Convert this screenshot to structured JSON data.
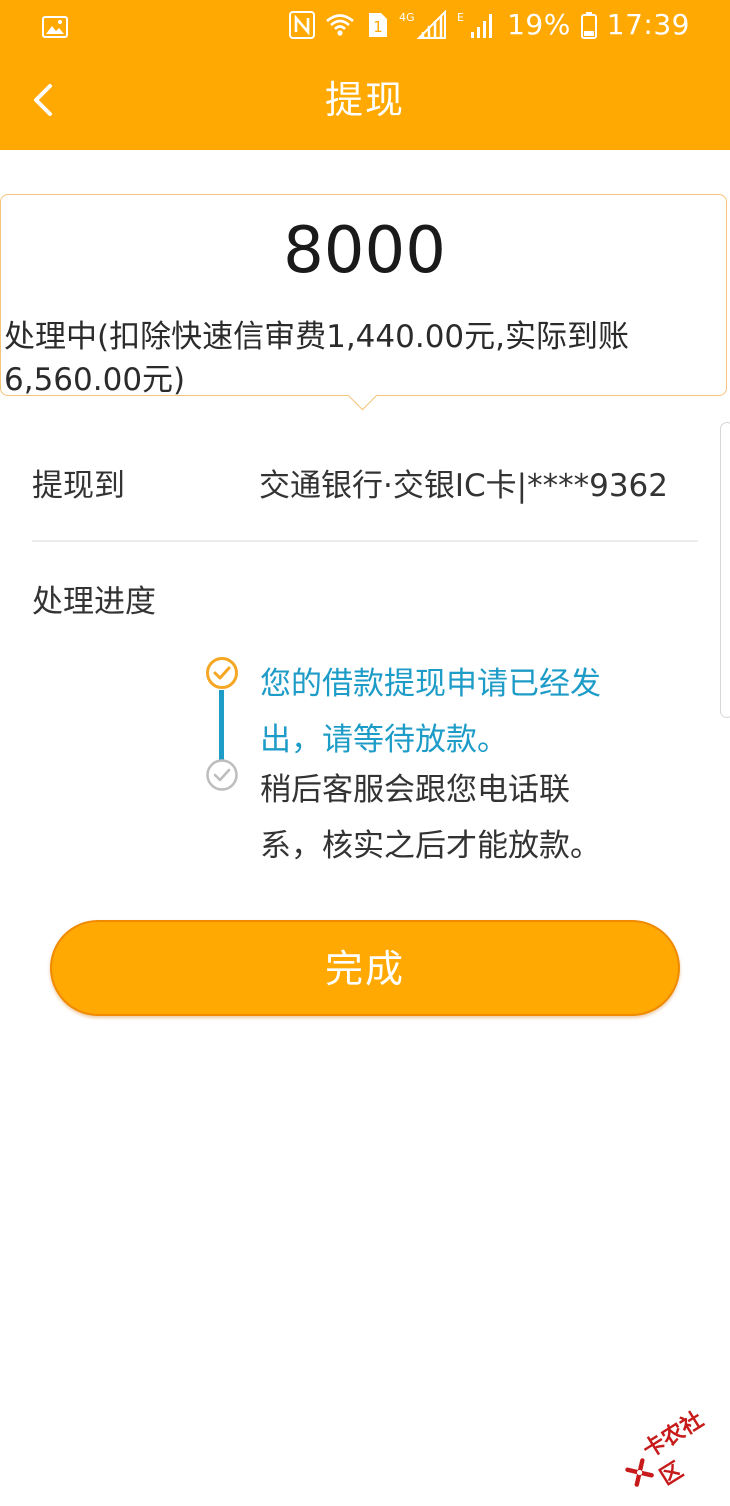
{
  "status_bar": {
    "battery_percent": "19%",
    "time": "17:39",
    "network_type": "4G",
    "mobile_data": "E",
    "sim_badge": "1",
    "icons": [
      "gallery-icon",
      "nfc-icon",
      "wifi-icon",
      "signal-icon",
      "battery-icon"
    ]
  },
  "header": {
    "title": "提现",
    "back_icon": "chevron-left-icon",
    "background_color": "#FFA902"
  },
  "amount_card": {
    "amount": "8000",
    "status_text": "处理中(扣除快速信审费1,440.00元,实际到账6,560.00元)"
  },
  "withdraw_row": {
    "label": "提现到",
    "value": "交通银行·交银IC卡|****9362"
  },
  "progress": {
    "label": "处理进度",
    "steps": [
      {
        "lines": [
          "您的借款提现申请已经发",
          "出，请等待放款。"
        ],
        "state": "done",
        "icon": "check-circle-icon",
        "color": "#1E9CC8"
      },
      {
        "lines": [
          "稍后客服会跟您电话联",
          "系，核实之后才能放款。"
        ],
        "state": "pending",
        "icon": "check-circle-icon",
        "color": "#333333"
      }
    ]
  },
  "done_button": {
    "label": "完成"
  },
  "watermark": {
    "text": "卡农社区"
  }
}
